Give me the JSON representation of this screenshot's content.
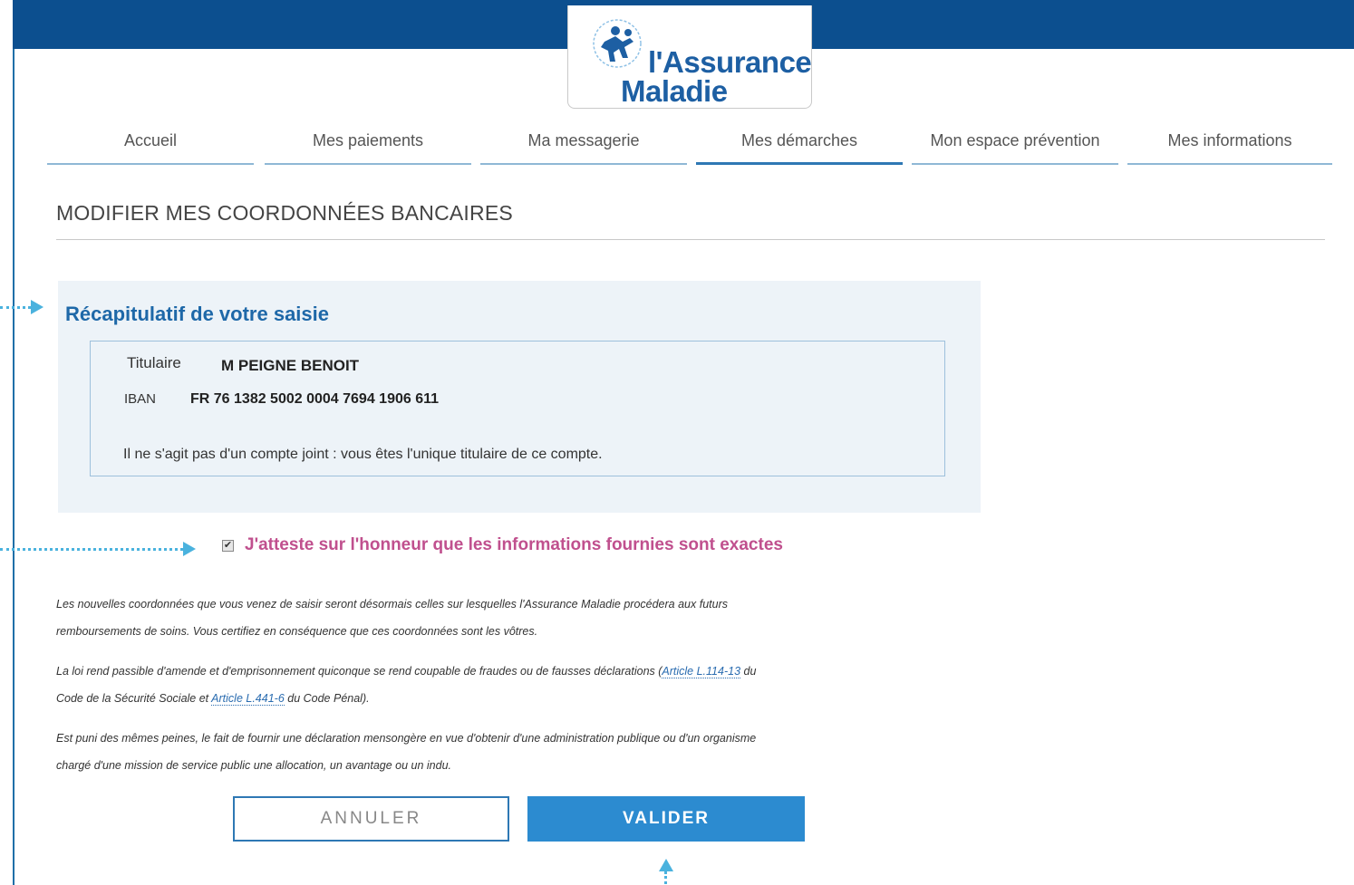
{
  "brand": {
    "logo_line1": "l'Assurance",
    "logo_line2": "Maladie",
    "primary_color": "#0c4f8f",
    "accent_color": "#1d5fa3"
  },
  "nav": {
    "tabs": [
      {
        "label": "Accueil",
        "active": false
      },
      {
        "label": "Mes paiements",
        "active": false
      },
      {
        "label": "Ma messagerie",
        "active": false
      },
      {
        "label": "Mes démarches",
        "active": true
      },
      {
        "label": "Mon espace prévention",
        "active": false
      },
      {
        "label": "Mes informations",
        "active": false
      }
    ]
  },
  "page": {
    "title": "MODIFIER MES COORDONNÉES BANCAIRES"
  },
  "summary": {
    "heading": "Récapitulatif de votre saisie",
    "holder_label": "Titulaire",
    "holder_value": "M PEIGNE BENOIT",
    "iban_label": "IBAN",
    "iban_value": "FR 76 1382 5002 0004 7694 1906 611",
    "joint_note": "Il ne s'agit pas d'un compte joint : vous êtes l'unique titulaire de ce compte."
  },
  "attestation": {
    "checked": true,
    "label": "J'atteste sur l'honneur que les informations fournies sont exactes",
    "color": "#c0508e"
  },
  "legal": {
    "p1_line1": "Les nouvelles coordonnées que vous venez de saisir seront désormais celles sur lesquelles l'Assurance Maladie procédera aux futurs",
    "p1_line2": "remboursements de soins. Vous certifiez en conséquence que ces coordonnées sont les vôtres.",
    "p2_before": "La loi rend passible d'amende et d'emprisonnement quiconque se rend coupable de fraudes ou de fausses déclarations (",
    "p2_link1": "Article L.114-13",
    "p2_middle1": " du",
    "p2_line2_before": "Code de la Sécurité Sociale et ",
    "p2_link2": "Article L.441-6",
    "p2_after": " du Code Pénal).",
    "p3_line1": "Est puni des mêmes peines, le fait de fournir une déclaration mensongère en vue d'obtenir d'une administration publique ou d'un organisme",
    "p3_line2": "chargé d'une mission de service public une allocation, un avantage ou un indu."
  },
  "actions": {
    "cancel_label": "ANNULER",
    "validate_label": "VALIDER"
  }
}
